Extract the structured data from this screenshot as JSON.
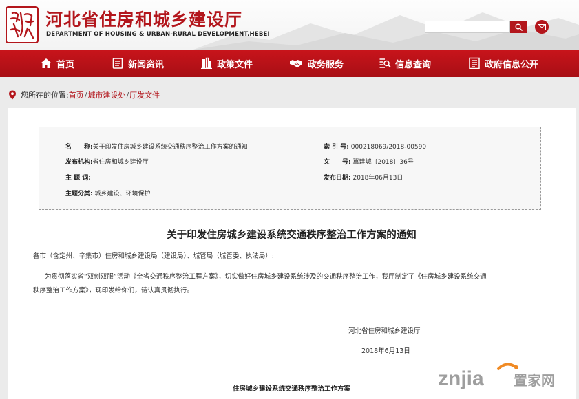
{
  "header": {
    "title": "河北省住房和城乡建设厅",
    "subtitle": "DEPARTMENT OF HOUSING & URBAN-RURAL DEVELOPMENT.HEBEI",
    "seal_icon": "seal-logo-icon",
    "search_placeholder": "",
    "accent_color": "#b3161c"
  },
  "nav": {
    "items": [
      {
        "label": "首页",
        "icon": "home-icon"
      },
      {
        "label": "新闻资讯",
        "icon": "news-icon"
      },
      {
        "label": "政策文件",
        "icon": "building-icon"
      },
      {
        "label": "政务服务",
        "icon": "handshake-icon"
      },
      {
        "label": "信息查询",
        "icon": "search-list-icon"
      },
      {
        "label": "政府信息公开",
        "icon": "document-list-icon"
      }
    ]
  },
  "breadcrumb": {
    "prefix": "您所在的位置:",
    "items": [
      "首页",
      "城市建设处",
      "厅发文件"
    ],
    "separator": "/"
  },
  "meta": {
    "name_label": "名　　称:",
    "name_value": "关于印发住房城乡建设系统交通秩序整治工作方案的通知",
    "publisher_label": "发布机构:",
    "publisher_value": "省住房和城乡建设厅",
    "subject_label": "主 题 词:",
    "subject_value": "",
    "category_label": "主题分类:",
    "category_value": "城乡建设、环境保护",
    "index_label": "索 引 号:",
    "index_value": "000218069/2018-00590",
    "docno_label": "文　　号:",
    "docno_value": "冀建城〔2018〕36号",
    "date_label": "发布日期:",
    "date_value": "2018年06月13日"
  },
  "document": {
    "title": "关于印发住房城乡建设系统交通秩序整治工作方案的通知",
    "salutation": "各市（含定州、辛集市）住房和城乡建设局（建设局）、城管局（城管委、执法局）:",
    "body_line1": "为贯彻落实省“双创双服”活动《全省交通秩序整治工程方案》，切实做好住房城乡建设系统涉及的交通秩序整治工作，我厅制定了《住房城乡建设系统交通",
    "body_line2": "秩序整治工作方案》，现印发给你们，请认真贯彻执行。",
    "signer": "河北省住房和城乡建设厅",
    "sign_date": "2018年6月13日",
    "attachment_title": "住房城乡建设系统交通秩序整治工作方案"
  },
  "watermark": {
    "brand": "znjia",
    "text": "置家网"
  }
}
